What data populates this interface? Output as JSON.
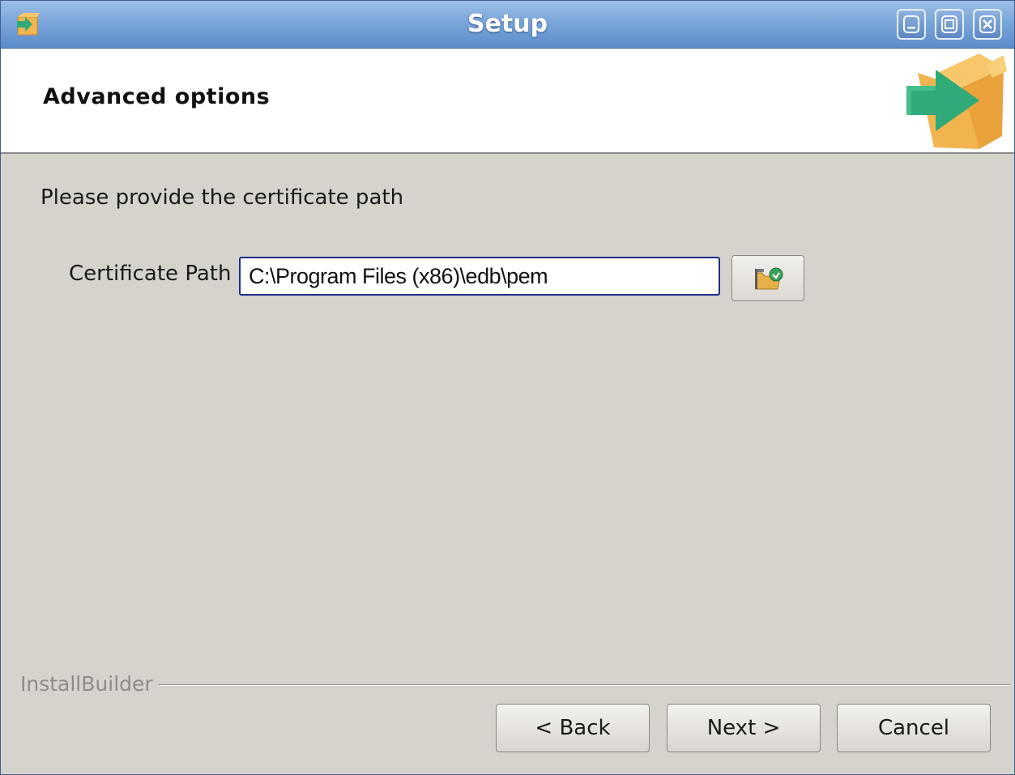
{
  "window": {
    "title": "Setup",
    "controls": {
      "minimize": "minimize-icon",
      "maximize": "maximize-icon",
      "close": "close-icon"
    }
  },
  "header": {
    "heading": "Advanced options",
    "logo_icon": "installer-box-arrow-icon"
  },
  "content": {
    "prompt": "Please provide the certificate path",
    "certificate_path": {
      "label": "Certificate Path",
      "value": "C:\\Program Files (x86)\\edb\\pem"
    },
    "browse_icon": "folder-browse-icon"
  },
  "footer": {
    "brand": "InstallBuilder",
    "back_label": "< Back",
    "next_label": "Next >",
    "cancel_label": "Cancel"
  },
  "colors": {
    "titlebar": "#7aa6da",
    "dialog_bg": "#d6d2cc",
    "input_focus_border": "#1c2f8a",
    "arrow_green": "#2faa78",
    "box_orange": "#f1b44f"
  }
}
